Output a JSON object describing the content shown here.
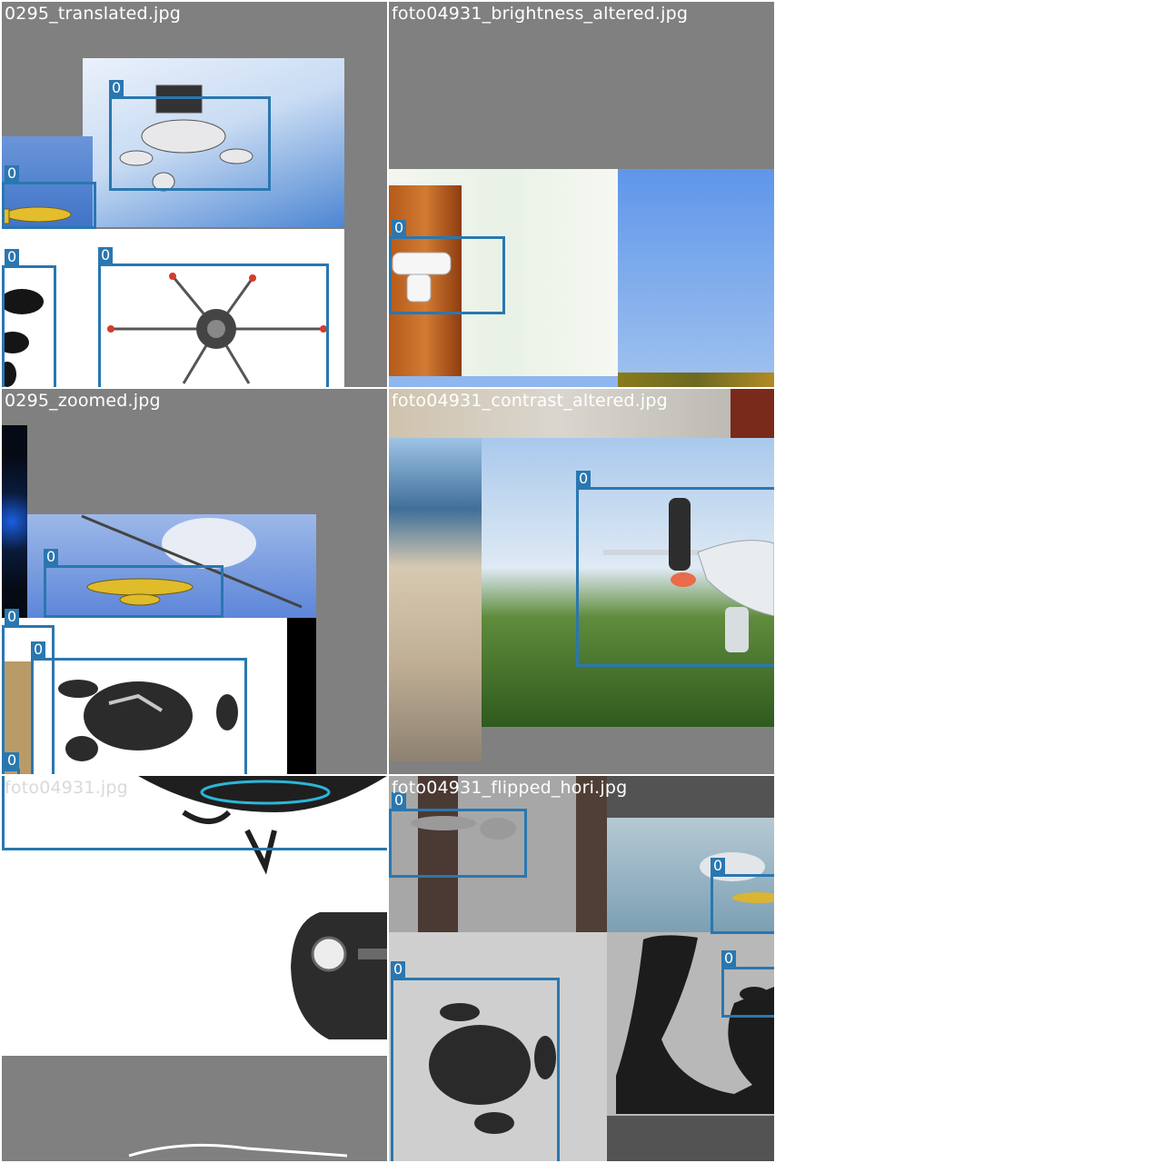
{
  "mosaic": {
    "tiles": [
      {
        "title": "0295_translated.jpg"
      },
      {
        "title": "foto04931_brightness_altered.jpg"
      },
      {
        "title": "0295_zoomed.jpg"
      },
      {
        "title": "foto04931_contrast_altered.jpg"
      },
      {
        "title": "foto04931.jpg"
      },
      {
        "title": "foto04931_flipped_hori.jpg"
      }
    ],
    "box_label": "0",
    "box_color": "#2a77b0",
    "background_color": "#808080"
  }
}
